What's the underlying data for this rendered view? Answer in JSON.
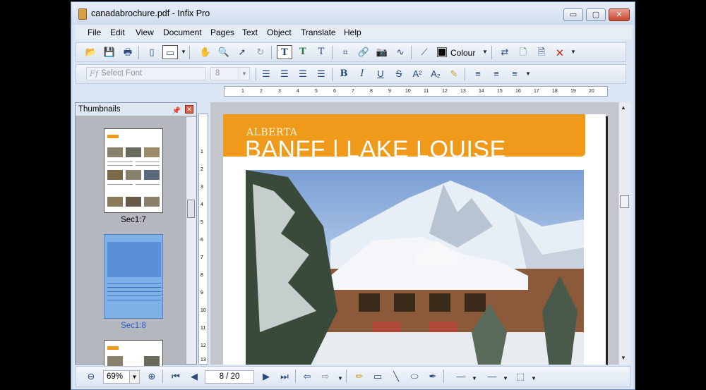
{
  "window": {
    "title": "canadabrochure.pdf - Infix Pro",
    "min_glyph": "▭",
    "max_glyph": "▢",
    "close_glyph": "✕"
  },
  "menu": [
    "File",
    "Edit",
    "View",
    "Document",
    "Pages",
    "Text",
    "Object",
    "Translate",
    "Help"
  ],
  "toolbar": {
    "colour_label": "Colour",
    "font_placeholder": "Select Font",
    "font_size": "8"
  },
  "ruler_h": [
    "1",
    "2",
    "3",
    "4",
    "5",
    "6",
    "7",
    "8",
    "9",
    "10",
    "11",
    "12",
    "13",
    "14",
    "15",
    "16",
    "17",
    "18",
    "19",
    "20"
  ],
  "ruler_v": [
    "1",
    "2",
    "3",
    "4",
    "5",
    "6",
    "7",
    "8",
    "9",
    "10",
    "11",
    "12",
    "13"
  ],
  "thumbnails": {
    "header": "Thumbnails",
    "items": [
      {
        "label": "Sec1:7"
      },
      {
        "label": "Sec1:8"
      }
    ]
  },
  "document": {
    "banner_sub": "ALBERTA",
    "banner_title": "BANFF | LAKE LOUISE"
  },
  "status": {
    "zoom": "69%",
    "page_indicator": "8 / 20"
  },
  "colors": {
    "banner": "#ef9a1a",
    "selected_thumb": "#7fb0e8"
  }
}
